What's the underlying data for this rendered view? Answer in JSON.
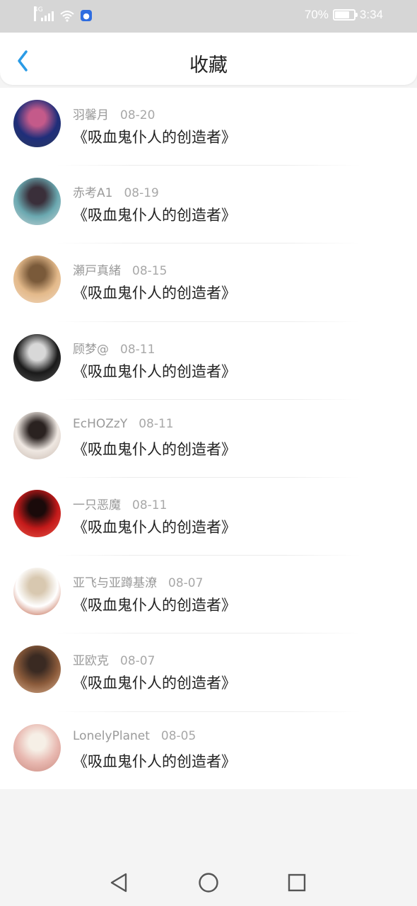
{
  "status_bar": {
    "network": "4G",
    "battery_text": "70%",
    "battery_level": 0.7,
    "time": "3:34"
  },
  "header": {
    "title": "收藏",
    "back_icon": "chevron-left-icon",
    "accent_color": "#2a9be6"
  },
  "favorites": [
    {
      "user": "羽馨月",
      "date": "08-20",
      "title": "《吸血鬼仆人的创造者》",
      "avatar_colors": [
        "#1f2e7a",
        "#c45a8a",
        "#2b3a5e"
      ]
    },
    {
      "user": "赤考A1",
      "date": "08-19",
      "title": "《吸血鬼仆人的创造者》",
      "avatar_colors": [
        "#6aa8b0",
        "#3a2f3a",
        "#c9d6d8"
      ]
    },
    {
      "user": "瀬戸真緒",
      "date": "08-15",
      "title": "《吸血鬼仆人的创造者》",
      "avatar_colors": [
        "#e3b98a",
        "#7a5a3a",
        "#f2d9c0"
      ]
    },
    {
      "user": "顾梦@",
      "date": "08-11",
      "title": "《吸血鬼仆人的创造者》",
      "avatar_colors": [
        "#1a1a1a",
        "#d8d8d8",
        "#555555"
      ]
    },
    {
      "user": "EcHOZzY",
      "date": "08-11",
      "title": "《吸血鬼仆人的创造者》",
      "avatar_colors": [
        "#efe8e2",
        "#2a2220",
        "#c7b8ae"
      ]
    },
    {
      "user": "一只恶魔",
      "date": "08-11",
      "title": "《吸血鬼仆人的创造者》",
      "avatar_colors": [
        "#c41a1a",
        "#1a0a0a",
        "#e85a4a"
      ]
    },
    {
      "user": "亚飞与亚蹲基潦",
      "date": "08-07",
      "title": "《吸血鬼仆人的创造者》",
      "avatar_colors": [
        "#ffffff",
        "#d8c8b0",
        "#b54a2a"
      ]
    },
    {
      "user": "亚欧克",
      "date": "08-07",
      "title": "《吸血鬼仆人的创造者》",
      "avatar_colors": [
        "#8a5a3a",
        "#3a2a22",
        "#d9b090"
      ]
    },
    {
      "user": "LonelyPlanet",
      "date": "08-05",
      "title": "《吸血鬼仆人的创造者》",
      "avatar_colors": [
        "#e8b8b0",
        "#f6efe6",
        "#c98a80"
      ]
    }
  ],
  "system_nav": {
    "back_icon": "triangle-back-icon",
    "home_icon": "circle-home-icon",
    "recents_icon": "square-recents-icon"
  }
}
